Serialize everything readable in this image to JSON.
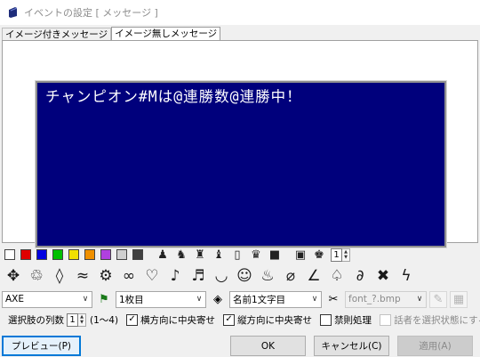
{
  "window": {
    "title": "イベントの設定 [ メッセージ ]",
    "icon": "book-icon"
  },
  "tabs": [
    {
      "label": "イメージ付きメッセージ",
      "active": false
    },
    {
      "label": "イメージ無しメッセージ",
      "active": true
    }
  ],
  "preview": {
    "message": "チャンピオン#Mは@連勝数@連勝中！",
    "background": "#00007c",
    "text_color": "#ffffff"
  },
  "color_swatches": [
    "#ffffff",
    "#e00000",
    "#0000e0",
    "#00c000",
    "#f0e000",
    "#f09000",
    "#b040e0",
    "#d0d0d0",
    "#404040"
  ],
  "toolbar_icons": [
    "person-icon",
    "person-icon",
    "person-icon",
    "person-icon",
    "door-icon",
    "group-icon",
    "building-icon",
    "building-icon",
    "person-icon"
  ],
  "page_spinner": {
    "value": "1"
  },
  "emotes": [
    "sparkle-icon",
    "recycle-icon",
    "diamond-icon",
    "wave-icon",
    "twist-icon",
    "swirl-icon",
    "heart-icon",
    "music-icon",
    "sweat-icon",
    "smile-icon",
    "happy-icon",
    "storm-icon",
    "drop-icon",
    "squiggle-icon",
    "spade-icon",
    "loop-icon",
    "cross-icon",
    "lightning-icon"
  ],
  "options_row": {
    "name_combo": "AXE",
    "flag_icon": "flag-icon",
    "page_combo": "1枚目",
    "pin_icon": "pin-icon",
    "name_char_combo": "名前1文字目",
    "tool_icon": "scissors-icon",
    "font_combo": "font_?.bmp",
    "font_button_icon": "folder-icon",
    "grid_button_icon": "grid-icon"
  },
  "settings_row": {
    "choice_count_label": "選択肢の列数",
    "choice_count_value": "1",
    "range_label": "(1〜4)",
    "h_center_label": "横方向に中央寄せ",
    "h_center_checked": true,
    "v_center_label": "縦方向に中央寄せ",
    "v_center_checked": true,
    "kinsoku_label": "禁則処理",
    "kinsoku_checked": false,
    "speaker_label": "話者を選択状態にする",
    "speaker_checked": false,
    "check_mark": "✓"
  },
  "buttons": {
    "preview": "プレビュー(P)",
    "ok": "OK",
    "cancel": "キャンセル(C)",
    "apply": "適用(A)"
  }
}
